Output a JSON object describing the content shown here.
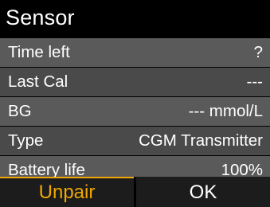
{
  "screen": {
    "title": "Sensor"
  },
  "rows": [
    {
      "label": "Time left",
      "value": "?"
    },
    {
      "label": "Last Cal",
      "value": "---"
    },
    {
      "label": "BG",
      "value": "--- mmol/L"
    },
    {
      "label": "Type",
      "value": "CGM Transmitter"
    },
    {
      "label": "Battery life",
      "value": "100%"
    }
  ],
  "softkeys": {
    "left_label": "Unpair",
    "right_label": "OK"
  },
  "colors": {
    "background": "#000000",
    "row_light": "#5a5a5a",
    "row_dark": "#4a4a4a",
    "accent": "#f0a800",
    "text": "#ffffff"
  }
}
